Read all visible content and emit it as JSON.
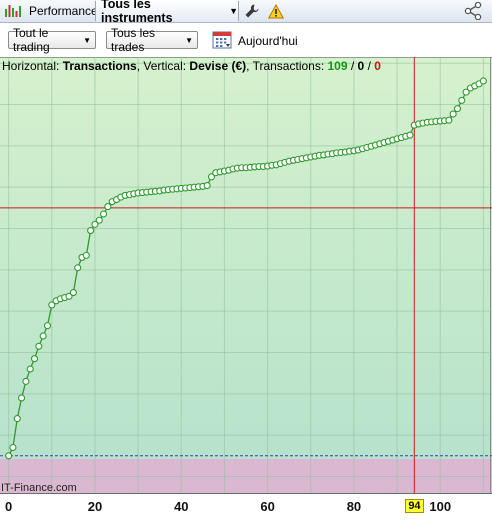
{
  "topbar": {
    "performance_label": "Performance",
    "instruments_label": "Tous les instruments"
  },
  "filters": {
    "trading_label": "Tout le trading",
    "trades_label": "Tous les trades",
    "date_label": "Aujourd'hui"
  },
  "info": {
    "horizontal_prefix": "Horizontal: ",
    "horizontal_value": "Transactions",
    "vertical_prefix": ", Vertical: ",
    "vertical_value": "Devise (€)",
    "count_prefix": ", Transactions: ",
    "count_total": "109",
    "sep1": " / ",
    "count_mid": "0",
    "sep2": " / ",
    "count_last": "0"
  },
  "watermark": "IT-Finance.com",
  "cursor": {
    "x": 94,
    "label": "94"
  },
  "chart_data": {
    "type": "line",
    "x_ticks": [
      "0",
      "20",
      "40",
      "60",
      "80",
      "100"
    ],
    "xlim": [
      -2,
      112
    ],
    "ylim": [
      -0.09,
      0.965
    ],
    "y_crosshair": 0.6,
    "baseline": 0,
    "series": [
      {
        "points": [
          [
            0,
            0
          ],
          [
            1,
            0.02
          ],
          [
            2,
            0.09
          ],
          [
            3,
            0.14
          ],
          [
            4,
            0.18
          ],
          [
            5,
            0.21
          ],
          [
            6,
            0.235
          ],
          [
            7,
            0.265
          ],
          [
            8,
            0.29
          ],
          [
            9,
            0.315
          ],
          [
            10,
            0.365
          ],
          [
            11,
            0.375
          ],
          [
            12,
            0.38
          ],
          [
            13,
            0.383
          ],
          [
            14,
            0.386
          ],
          [
            15,
            0.395
          ],
          [
            16,
            0.455
          ],
          [
            17,
            0.48
          ],
          [
            18,
            0.485
          ],
          [
            19,
            0.545
          ],
          [
            20,
            0.56
          ],
          [
            21,
            0.57
          ],
          [
            22,
            0.585
          ],
          [
            23,
            0.603
          ],
          [
            24,
            0.615
          ],
          [
            25,
            0.62
          ],
          [
            26,
            0.626
          ],
          [
            27,
            0.63
          ],
          [
            28,
            0.632
          ],
          [
            29,
            0.634
          ],
          [
            30,
            0.636
          ],
          [
            31,
            0.637
          ],
          [
            32,
            0.638
          ],
          [
            33,
            0.639
          ],
          [
            34,
            0.64
          ],
          [
            35,
            0.641
          ],
          [
            36,
            0.643
          ],
          [
            37,
            0.644
          ],
          [
            38,
            0.645
          ],
          [
            39,
            0.646
          ],
          [
            40,
            0.647
          ],
          [
            41,
            0.648
          ],
          [
            42,
            0.649
          ],
          [
            43,
            0.65
          ],
          [
            44,
            0.651
          ],
          [
            45,
            0.652
          ],
          [
            46,
            0.654
          ],
          [
            47,
            0.675
          ],
          [
            48,
            0.685
          ],
          [
            49,
            0.687
          ],
          [
            50,
            0.689
          ],
          [
            51,
            0.691
          ],
          [
            52,
            0.694
          ],
          [
            53,
            0.696
          ],
          [
            54,
            0.697
          ],
          [
            55,
            0.697
          ],
          [
            56,
            0.698
          ],
          [
            57,
            0.699
          ],
          [
            58,
            0.7
          ],
          [
            59,
            0.7
          ],
          [
            60,
            0.701
          ],
          [
            61,
            0.703
          ],
          [
            62,
            0.704
          ],
          [
            63,
            0.707
          ],
          [
            64,
            0.71
          ],
          [
            65,
            0.713
          ],
          [
            66,
            0.715
          ],
          [
            67,
            0.717
          ],
          [
            68,
            0.719
          ],
          [
            69,
            0.721
          ],
          [
            70,
            0.723
          ],
          [
            71,
            0.725
          ],
          [
            72,
            0.727
          ],
          [
            73,
            0.728
          ],
          [
            74,
            0.73
          ],
          [
            75,
            0.731
          ],
          [
            76,
            0.733
          ],
          [
            77,
            0.734
          ],
          [
            78,
            0.735
          ],
          [
            79,
            0.737
          ],
          [
            80,
            0.738
          ],
          [
            81,
            0.74
          ],
          [
            82,
            0.743
          ],
          [
            83,
            0.746
          ],
          [
            84,
            0.749
          ],
          [
            85,
            0.752
          ],
          [
            86,
            0.755
          ],
          [
            87,
            0.758
          ],
          [
            88,
            0.761
          ],
          [
            89,
            0.764
          ],
          [
            90,
            0.767
          ],
          [
            91,
            0.77
          ],
          [
            92,
            0.773
          ],
          [
            93,
            0.776
          ],
          [
            94,
            0.8
          ],
          [
            95,
            0.803
          ],
          [
            96,
            0.805
          ],
          [
            97,
            0.807
          ],
          [
            98,
            0.808
          ],
          [
            99,
            0.809
          ],
          [
            100,
            0.81
          ],
          [
            101,
            0.811
          ],
          [
            102,
            0.812
          ],
          [
            103,
            0.827
          ],
          [
            104,
            0.84
          ],
          [
            105,
            0.86
          ],
          [
            106,
            0.88
          ],
          [
            107,
            0.89
          ],
          [
            108,
            0.895
          ],
          [
            109,
            0.9
          ],
          [
            110,
            0.907
          ]
        ]
      }
    ]
  },
  "colors": {
    "accent": "#ff9900",
    "line": "#2e9a2e",
    "count_total": "#119911",
    "count_last": "#cc1111",
    "crosshair": "#d01818",
    "highlight": "#ffff33"
  }
}
